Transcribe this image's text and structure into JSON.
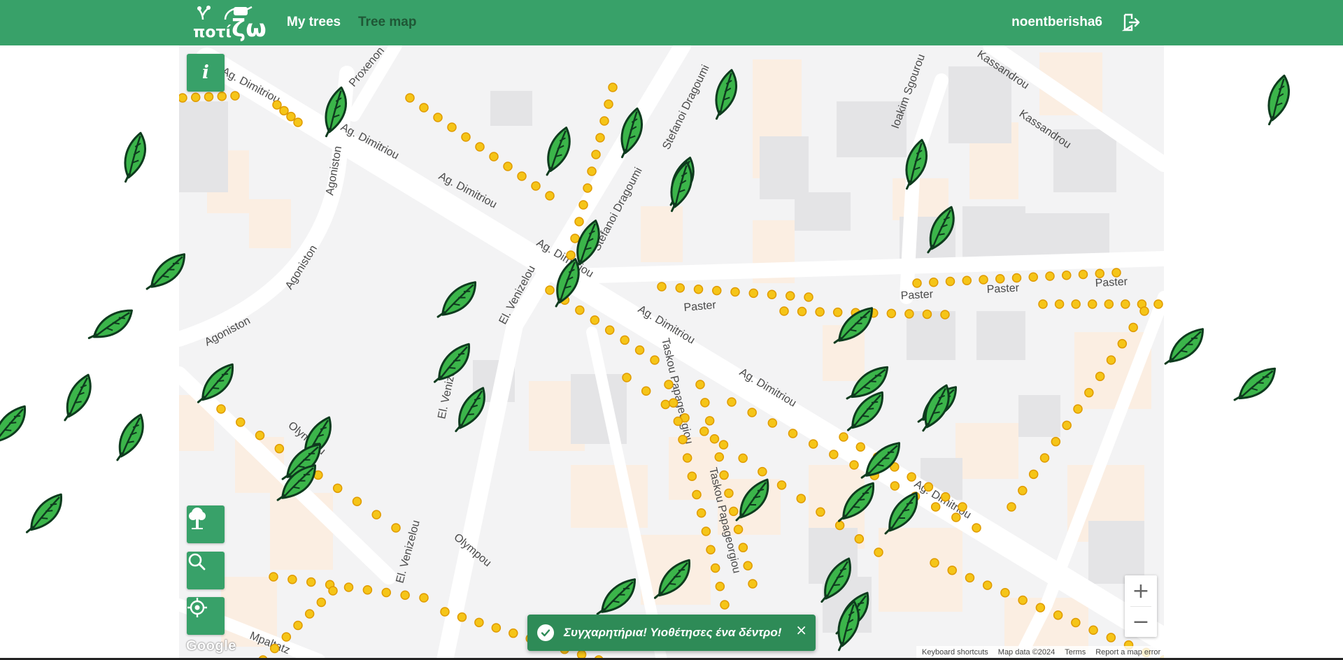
{
  "navbar": {
    "brand_small": "ποτί",
    "brand_big": "ζω",
    "links": [
      {
        "label": "My trees",
        "active": true
      },
      {
        "label": "Tree map",
        "active": false
      }
    ],
    "username": "noentberisha6",
    "logout_icon": "logout-icon"
  },
  "map": {
    "street_labels": [
      "Ag. Dimitriou",
      "Proxenon",
      "Ag. Dimitriou",
      "Ag. Dimitriou",
      "Ag. Dimitriou",
      "Ag. Dimitriou",
      "Ag. Dimitriou",
      "Ag. Dimitriou",
      "Agoniston",
      "Agoniston",
      "Agoniston",
      "Stefanoi Dragoumi",
      "Stefanoi Dragoumi",
      "El. Venizelou",
      "El. Venizelou",
      "El. Venizelou",
      "Olympou",
      "Olympou",
      "Taskou Papageorgiou",
      "Taskou Papageorgiou",
      "Paster",
      "Paster",
      "Paster",
      "Paster",
      "Ioakim Sgourou",
      "Kassandrou",
      "Kassandrou",
      "Mpaltatz"
    ],
    "controls": {
      "info_icon": "info-icon",
      "tree_icon": "tree-icon",
      "search_icon": "search-icon",
      "locate_icon": "locate-icon",
      "zoom_in": "+",
      "zoom_out": "−"
    },
    "google_logo": "Google",
    "attribution": {
      "shortcuts": "Keyboard shortcuts",
      "map_data": "Map data ©2024",
      "terms": "Terms",
      "report": "Report a map error"
    }
  },
  "toast": {
    "message": "Συγχαρητήρια! Υιοθέτησες ένα δέντρο!",
    "close": "×",
    "icon": "check-icon"
  },
  "colors": {
    "primary_green": "#38a169",
    "toast_green": "#2e8b57",
    "leaf_green": "#2ea043",
    "tree_marker": "#f5c518"
  }
}
